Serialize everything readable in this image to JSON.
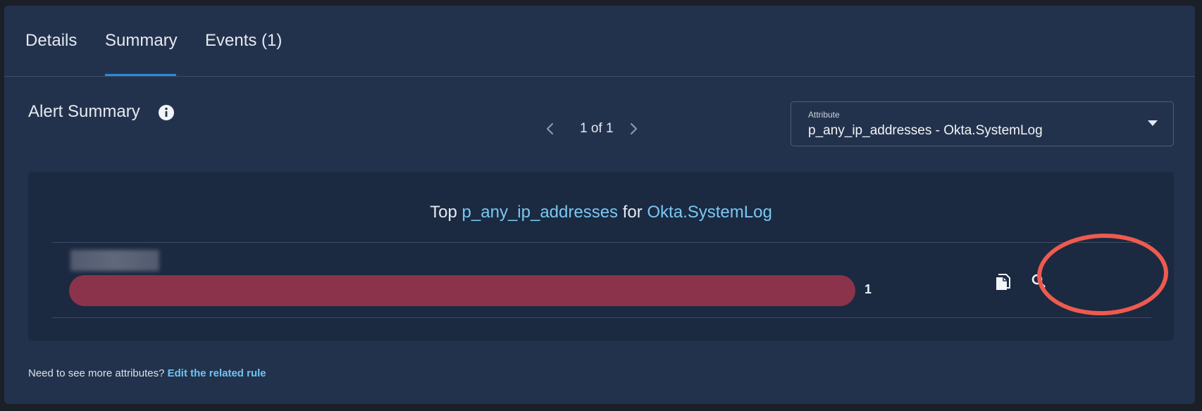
{
  "tabs": [
    {
      "label": "Details",
      "active": false
    },
    {
      "label": "Summary",
      "active": true
    },
    {
      "label": "Events (1)",
      "active": false
    }
  ],
  "section": {
    "title": "Alert Summary",
    "info_icon": "info-icon"
  },
  "pager": {
    "text": "1 of 1",
    "prev_icon": "chevron-left-icon",
    "next_icon": "chevron-right-icon"
  },
  "attribute_select": {
    "label": "Attribute",
    "value": "p_any_ip_addresses - Okta.SystemLog",
    "caret_icon": "caret-down-icon"
  },
  "summary_card": {
    "heading_prefix": "Top ",
    "attribute": "p_any_ip_addresses",
    "heading_middle": " for ",
    "log_type": "Okta.SystemLog",
    "rows": [
      {
        "count": "1",
        "fraction": 1.0,
        "label_redacted": true,
        "actions": [
          "copy-icon",
          "search-icon"
        ]
      }
    ]
  },
  "footer": {
    "text": "Need to see more attributes? ",
    "link": "Edit the related rule"
  },
  "colors": {
    "background": "#1b1f27",
    "panel": "#23324c",
    "card": "#1b2a41",
    "accent_tab": "#2b8ad8",
    "highlight_text": "#79c7f2",
    "bar": "#8c334c",
    "annotation_ring": "#ef5a4f"
  }
}
